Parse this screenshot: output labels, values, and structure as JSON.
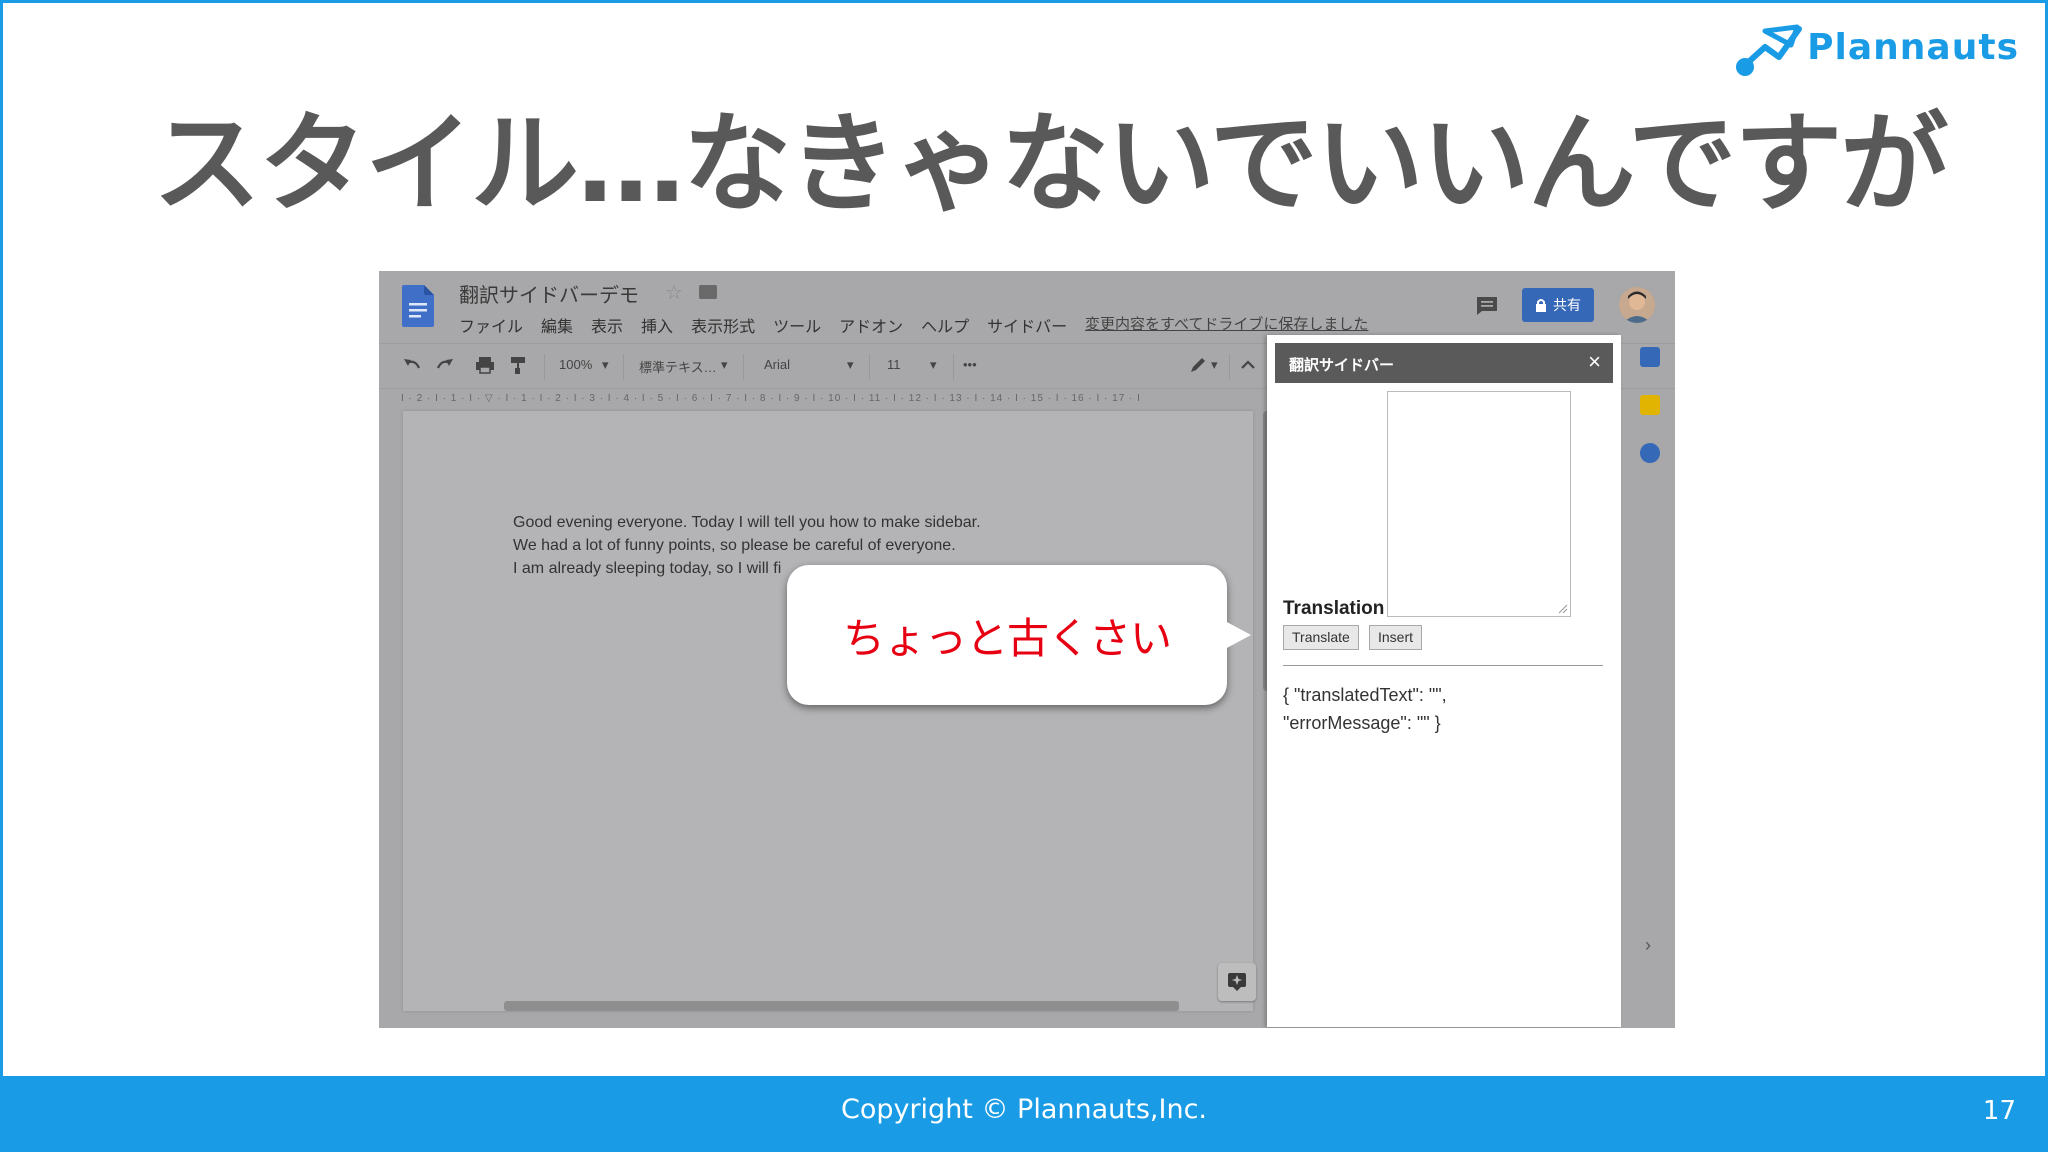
{
  "slide": {
    "title": "スタイル…なきゃないでいいんですが",
    "logo_text": "Plannauts",
    "copyright": "Copyright ©  Plannauts,Inc.",
    "page_number": "17"
  },
  "docs": {
    "doc_title": "翻訳サイドバーデモ",
    "menu": [
      "ファイル",
      "編集",
      "表示",
      "挿入",
      "表示形式",
      "ツール",
      "アドオン",
      "ヘルプ",
      "サイドバー"
    ],
    "save_status": "変更内容をすべてドライブに保存しました",
    "share_label": "共有",
    "toolbar": {
      "zoom": "100%",
      "style": "標準テキス…",
      "font": "Arial",
      "size": "11",
      "more": "•••"
    },
    "ruler": "I · 2 · I · 1 · I · ▽ · I · 1 · I · 2 · I · 3 · I · 4 · I · 5 · I · 6 · I · 7 · I · 8 · I · 9 · I · 10 · I · 11 · I · 12 · I · 13 · I · 14 · I · 15 · I · 16 · I · 17 · I",
    "lines": [
      "Good evening everyone. Today I will tell you how to make sidebar.",
      "We had a lot of funny points, so please be careful of everyone.",
      "I am already sleeping today, so I will fi"
    ]
  },
  "callout": {
    "text": "ちょっと古くさい"
  },
  "sidebar": {
    "title": "翻訳サイドバー",
    "close": "×",
    "label": "Translation",
    "translate_button": "Translate",
    "insert_button": "Insert",
    "output_line1": "{ \"translatedText\": \"\",",
    "output_line2": "\"errorMessage\": \"\" }"
  },
  "rail": {
    "chevron": "›"
  },
  "colors": {
    "brand_blue": "#1a9be6",
    "title_gray": "#595959",
    "callout_red": "#e60012",
    "share_blue": "#3668b8"
  }
}
